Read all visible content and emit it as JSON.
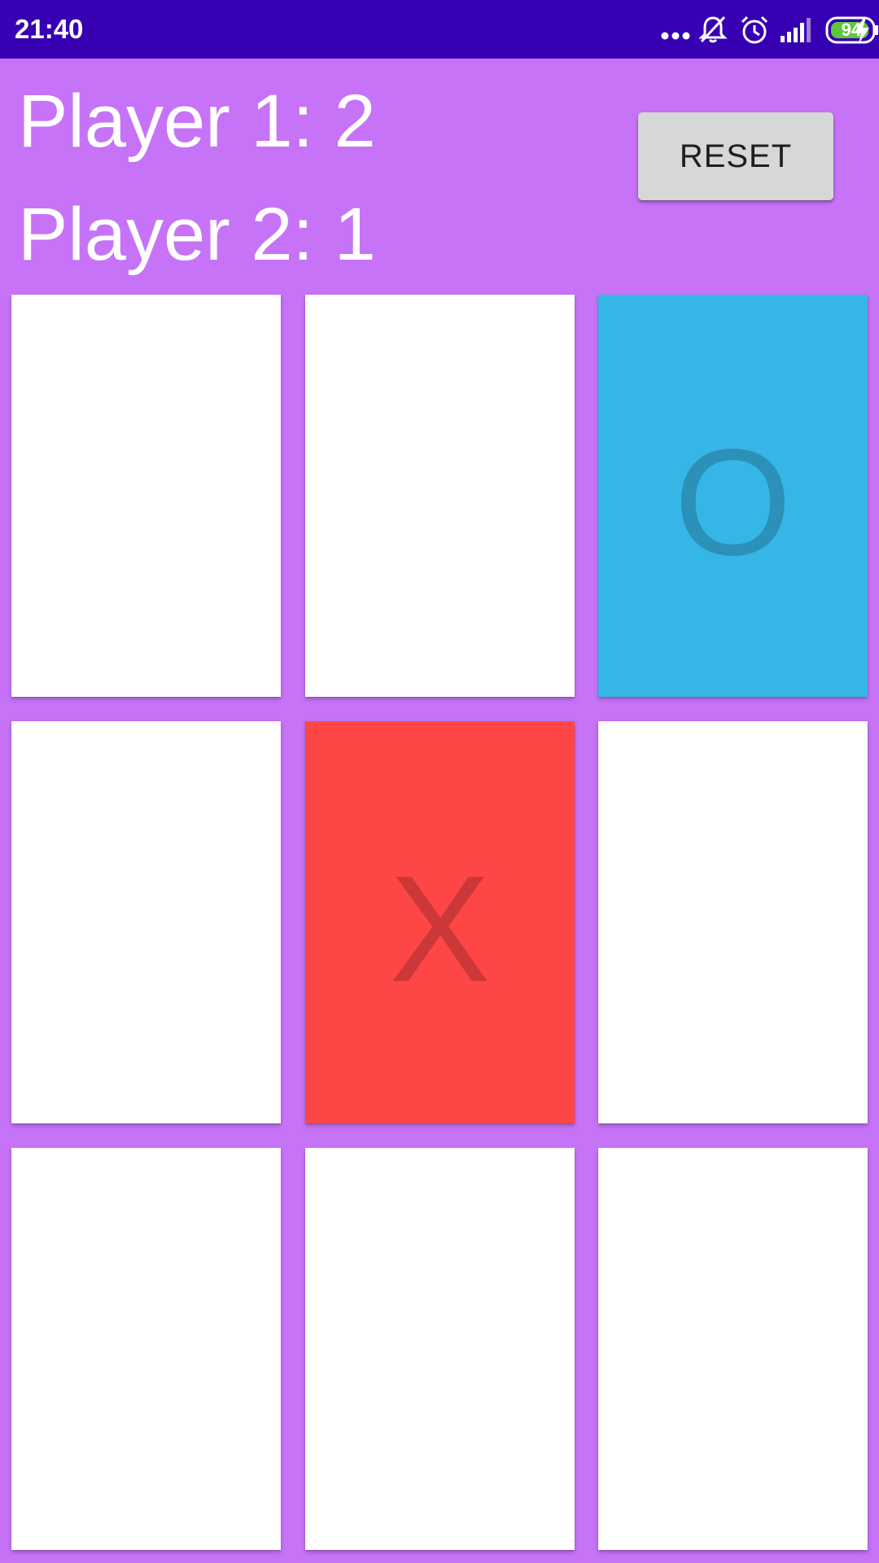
{
  "status_bar": {
    "time": "21:40",
    "battery_level": "94",
    "icons": [
      "more-dots-icon",
      "muted-bell-icon",
      "alarm-clock-icon",
      "signal-icon",
      "battery-icon",
      "charging-bolt-icon"
    ],
    "background_color": "#3700b3"
  },
  "game": {
    "player1_score_text": "Player 1: 2",
    "player2_score_text": "Player 2: 1",
    "reset_label": "RESET",
    "background_color": "#c673f8",
    "board": [
      [
        "",
        "",
        "O"
      ],
      [
        "",
        "X",
        ""
      ],
      [
        "",
        "",
        ""
      ]
    ],
    "cell_colors": {
      "empty": "#ffffff",
      "O": "#36b6e6",
      "X": "#ff4646"
    }
  }
}
